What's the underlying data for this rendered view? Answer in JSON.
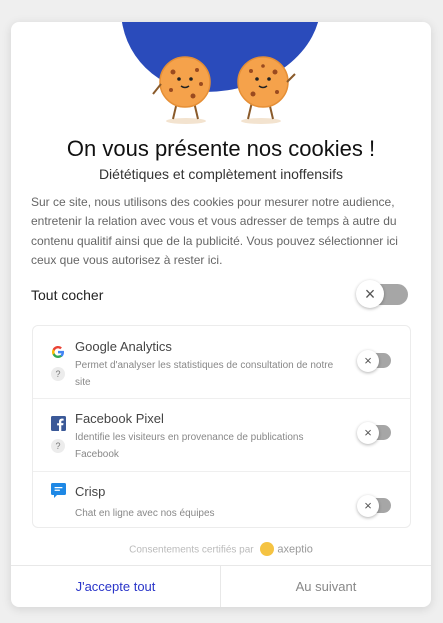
{
  "modal": {
    "title": "On vous présente nos cookies !",
    "subtitle": "Diététiques et complètement inoffensifs",
    "intro": "Sur ce site, nous utilisons des cookies pour mesurer notre audience, entretenir la relation avec vous et vous adresser de temps à autre du contenu qualitif ainsi que de la publicité. Vous pouvez sélectionner ici ceux que vous autorisez à rester ici.",
    "toggle_all_label": "Tout cocher",
    "toggle_all_glyph": "×",
    "services": [
      {
        "name": "Google Analytics",
        "description": "Permet d'analyser les statistiques de consultation de notre site",
        "help": "?",
        "toggle_glyph": "×",
        "icon": "google-icon"
      },
      {
        "name": "Facebook Pixel",
        "description": "Identifie les visiteurs en provenance de publications Facebook",
        "help": "?",
        "toggle_glyph": "×",
        "icon": "facebook-icon"
      },
      {
        "name": "Crisp",
        "description": "Chat en ligne avec nos équipes",
        "help": "?",
        "toggle_glyph": "×",
        "icon": "crisp-chat-icon"
      }
    ],
    "certified_text": "Consentements certifiés par",
    "brand_name": "axeptio",
    "accept_all_label": "J'accepte tout",
    "next_label": "Au suivant"
  },
  "colors": {
    "blob": "#2a4bbb",
    "accent": "#2a35c9",
    "toggle_off": "#a6a6a6",
    "brand": "#f5c342",
    "cookie": "#f5a24b"
  }
}
